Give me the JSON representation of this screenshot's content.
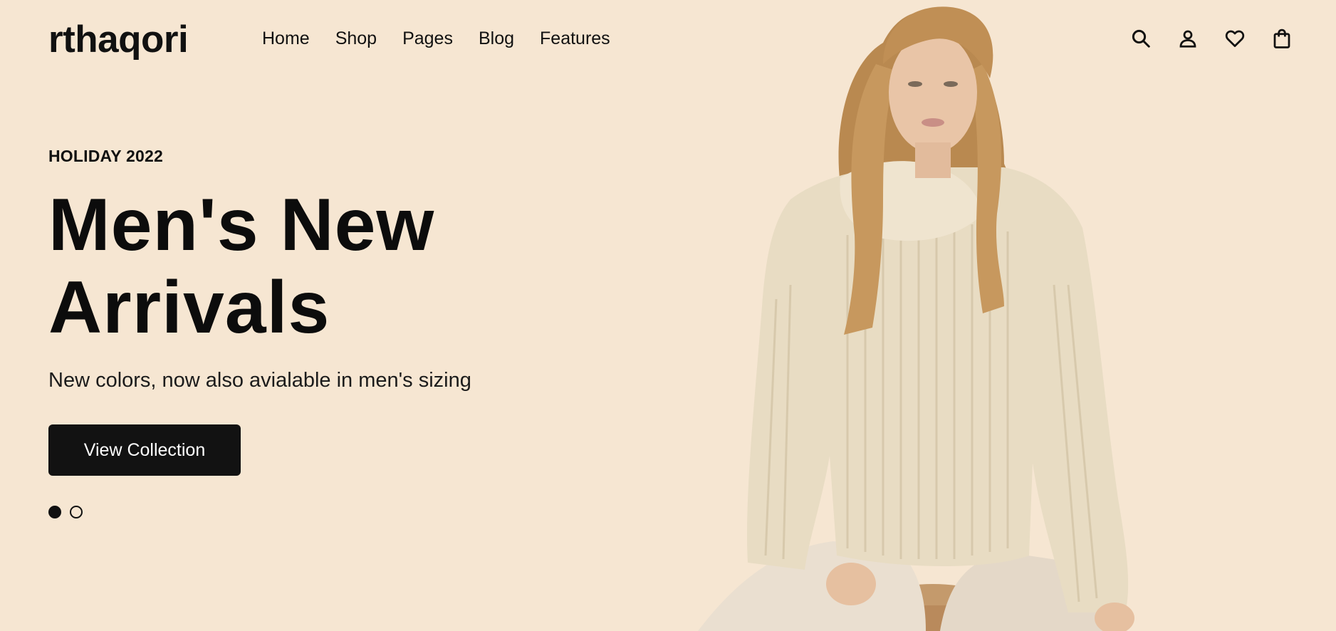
{
  "brand": {
    "logo_text": "rthaqori"
  },
  "nav": {
    "items": [
      {
        "label": "Home"
      },
      {
        "label": "Shop"
      },
      {
        "label": "Pages"
      },
      {
        "label": "Blog"
      },
      {
        "label": "Features"
      }
    ]
  },
  "header_icons": [
    {
      "icon": "search-icon"
    },
    {
      "icon": "user-icon"
    },
    {
      "icon": "heart-icon"
    },
    {
      "icon": "shopping-bag-icon"
    }
  ],
  "hero": {
    "eyebrow": "HOLIDAY 2022",
    "title_line_1": "Men's New",
    "title_line_2": "Arrivals",
    "subtitle": "New colors, now also avialable in men's sizing",
    "cta_label": "View Collection",
    "slides_total": 2,
    "active_slide": 1
  },
  "colors": {
    "background": "#f6e6d2",
    "text": "#111111",
    "button": "#121212",
    "button_text": "#ffffff"
  }
}
